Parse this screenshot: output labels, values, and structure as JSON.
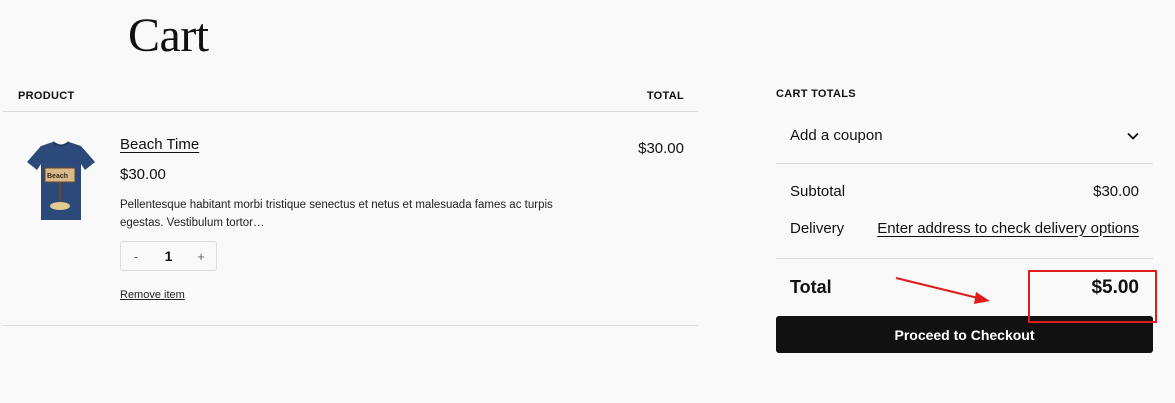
{
  "page": {
    "title": "Cart"
  },
  "items_table": {
    "headers": {
      "product": "PRODUCT",
      "total": "TOTAL"
    },
    "items": [
      {
        "name": "Beach Time",
        "price": "$30.00",
        "description": "Pellentesque habitant morbi tristique senectus et netus et malesuada fames ac turpis egestas. Vestibulum tortor…",
        "quantity": "1",
        "qty_minus": "-",
        "qty_plus": "+",
        "remove_label": "Remove item",
        "line_total": "$30.00",
        "thumbnail_sign_text": "Beach"
      }
    ]
  },
  "totals": {
    "header": "CART TOTALS",
    "coupon_label": "Add a coupon",
    "coupon_icon": "chevron-down-icon",
    "subtotal_label": "Subtotal",
    "subtotal_value": "$30.00",
    "delivery_label": "Delivery",
    "delivery_link": "Enter address to check delivery options",
    "total_label": "Total",
    "total_value": "$5.00",
    "checkout_label": "Proceed to Checkout"
  },
  "annotation": {
    "highlight_color": "#e01b1b"
  },
  "colors": {
    "background": "#f9f9f9",
    "button": "#111111",
    "shirt": "#2b4a7a"
  }
}
